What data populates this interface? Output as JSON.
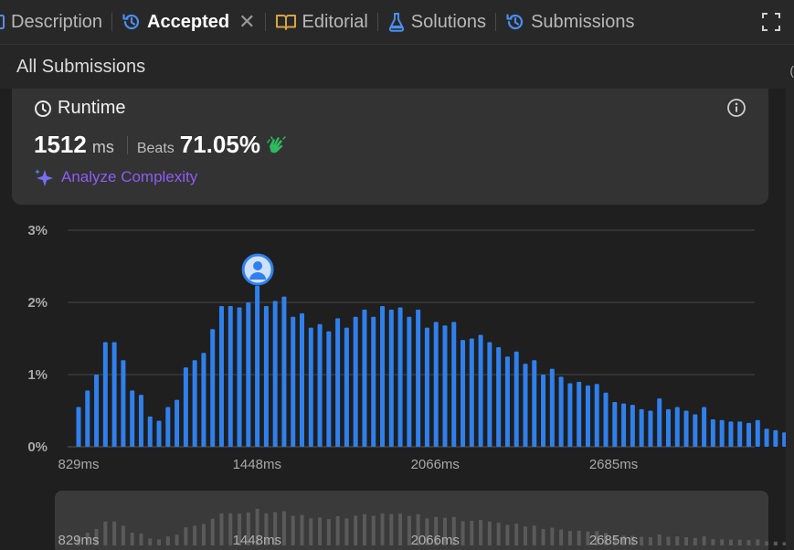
{
  "tabs": [
    {
      "label": "Description",
      "icon": "description-icon"
    },
    {
      "label": "Accepted",
      "icon": "history-icon",
      "active": true,
      "close_icon": "close-icon"
    },
    {
      "label": "Editorial",
      "icon": "book-icon"
    },
    {
      "label": "Solutions",
      "icon": "flask-icon"
    },
    {
      "label": "Submissions",
      "icon": "history-icon"
    }
  ],
  "expand_icon": "fullscreen-icon",
  "subbar": {
    "back_icon": "chevron-left-icon",
    "label": "All Submissions"
  },
  "runtime": {
    "title": "Runtime",
    "value": "1512",
    "unit": "ms",
    "beats_label": "Beats",
    "beats_pct": "71.05%",
    "analyze_label": "Analyze Complexity",
    "clock_icon": "clock-icon",
    "info_icon": "info-icon",
    "hand_icon": "clap-hands-icon",
    "sparkle_icon": "sparkle-icon"
  },
  "colors": {
    "bar": "#2f80ed",
    "mini_bar": "#5a5a5a",
    "accent_purple": "#8e5cf6",
    "hand_green": "#2cbb5d"
  },
  "chart_data": {
    "type": "bar",
    "title": "",
    "xlabel": "",
    "ylabel": "",
    "y_ticks": [
      "3%",
      "2%",
      "1%",
      "0%"
    ],
    "ylim": [
      0,
      3
    ],
    "x_ticks": [
      "829ms",
      "1448ms",
      "2066ms",
      "2685ms"
    ],
    "x_range": [
      829,
      3221
    ],
    "bin_width_ms": 31,
    "grid": true,
    "highlight_bar_index": 20,
    "avatar_icon": "user-avatar-icon",
    "values": [
      0.55,
      0.78,
      1.0,
      1.45,
      1.45,
      1.2,
      0.78,
      0.72,
      0.42,
      0.36,
      0.55,
      0.65,
      1.1,
      1.2,
      1.3,
      1.63,
      1.95,
      1.95,
      1.93,
      2.0,
      2.23,
      1.95,
      2.02,
      2.08,
      1.8,
      1.85,
      1.65,
      1.7,
      1.6,
      1.78,
      1.65,
      1.8,
      1.9,
      1.8,
      1.95,
      1.9,
      1.93,
      1.8,
      1.9,
      1.65,
      1.73,
      1.68,
      1.73,
      1.48,
      1.5,
      1.55,
      1.45,
      1.38,
      1.25,
      1.32,
      1.15,
      1.2,
      1.0,
      1.08,
      0.97,
      0.88,
      0.9,
      0.85,
      0.87,
      0.75,
      0.62,
      0.6,
      0.58,
      0.52,
      0.5,
      0.67,
      0.52,
      0.55,
      0.5,
      0.45,
      0.55,
      0.38,
      0.37,
      0.35,
      0.35,
      0.33,
      0.37,
      0.25,
      0.23,
      0.2,
      0.22
    ],
    "mini_x_ticks": [
      "829ms",
      "1448ms",
      "2066ms",
      "2685ms"
    ]
  }
}
